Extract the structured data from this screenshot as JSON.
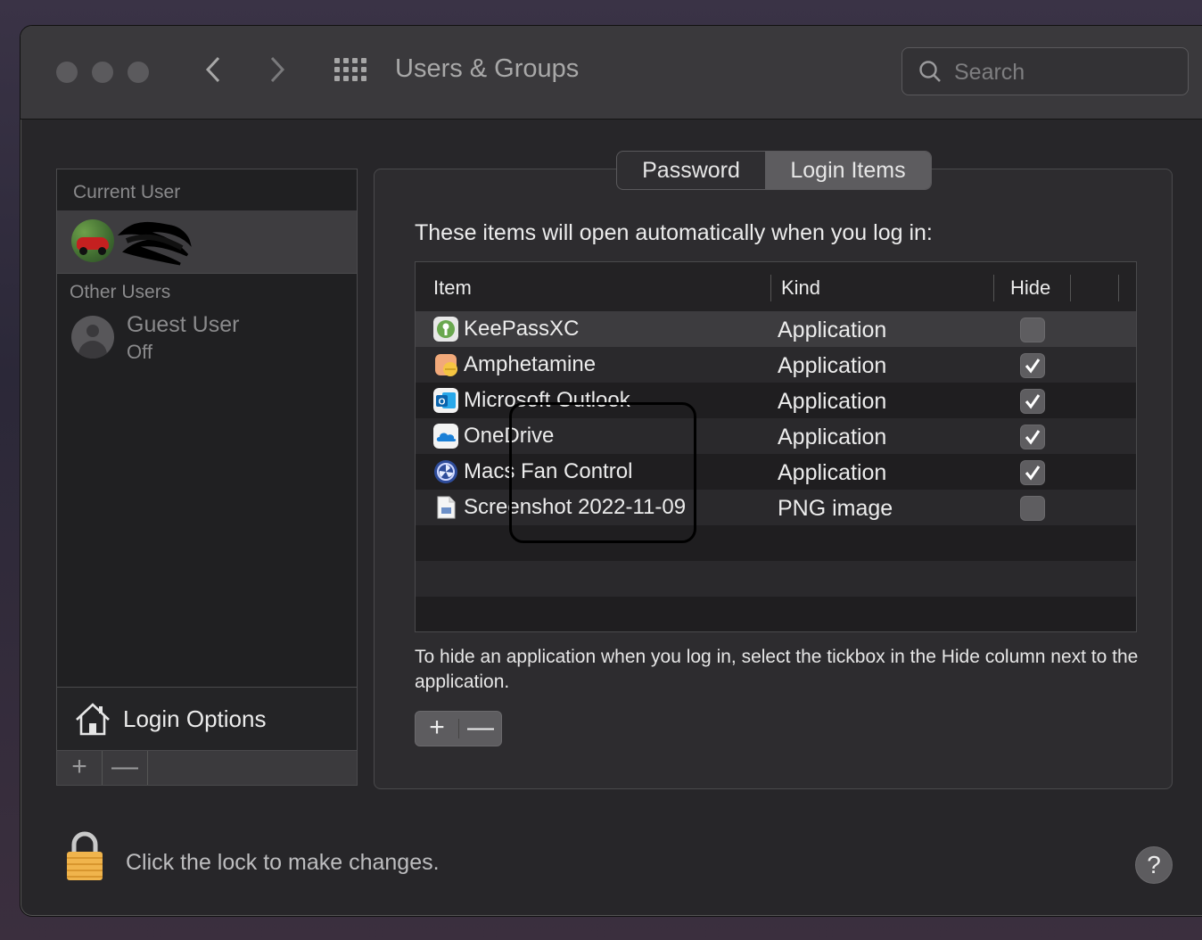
{
  "window": {
    "title": "Users & Groups",
    "search_placeholder": "Search"
  },
  "sidebar": {
    "current_user_label": "Current User",
    "other_users_label": "Other Users",
    "guest_user": {
      "name": "Guest User",
      "status": "Off"
    },
    "login_options_label": "Login Options",
    "add_label": "+",
    "remove_label": "—"
  },
  "tabs": [
    {
      "label": "Password",
      "active": false
    },
    {
      "label": "Login Items",
      "active": true
    }
  ],
  "intro_text": "These items will open automatically when you log in:",
  "table": {
    "columns": [
      "Item",
      "Kind",
      "Hide"
    ],
    "rows": [
      {
        "name": "KeePassXC",
        "kind": "Application",
        "hide": false,
        "icon": "keepassxc-icon"
      },
      {
        "name": "Amphetamine",
        "kind": "Application",
        "hide": true,
        "icon": "amphetamine-icon"
      },
      {
        "name": "Microsoft Outlook",
        "kind": "Application",
        "hide": true,
        "icon": "outlook-icon"
      },
      {
        "name": "OneDrive",
        "kind": "Application",
        "hide": true,
        "icon": "onedrive-icon"
      },
      {
        "name": "Macs Fan Control",
        "kind": "Application",
        "hide": true,
        "icon": "fan-control-icon"
      },
      {
        "name": "Screenshot 2022-11-09",
        "kind": "PNG image",
        "hide": false,
        "icon": "png-file-icon"
      }
    ]
  },
  "hint_text": "To hide an application when you log in, select the tickbox in the Hide column next to the application.",
  "add_label": "+",
  "remove_label": "—",
  "lock_text": "Click the lock to make changes.",
  "help_label": "?"
}
